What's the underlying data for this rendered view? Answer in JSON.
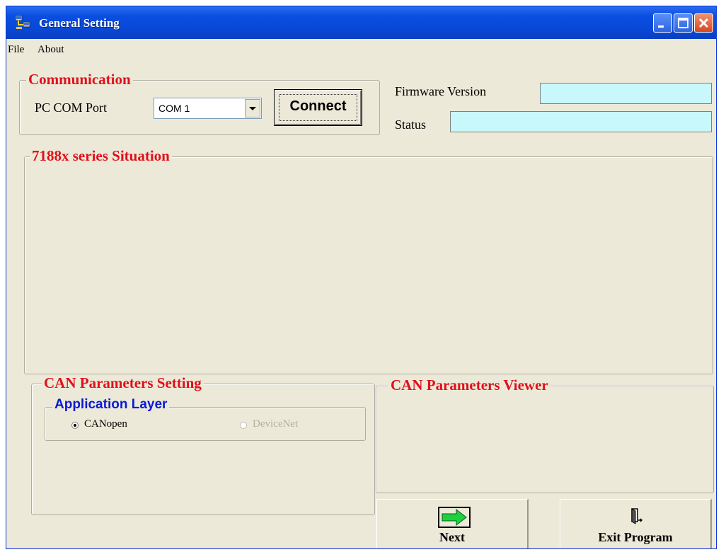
{
  "window": {
    "title": "General Setting",
    "controls": [
      "minimize",
      "maximize",
      "close"
    ]
  },
  "menu": {
    "items": [
      "File",
      "About"
    ]
  },
  "communication": {
    "legend": "Communication",
    "port_label": "PC COM Port",
    "port_value": "COM 1",
    "connect_label": "Connect"
  },
  "info": {
    "firmware_label": "Firmware Version",
    "firmware_value": "",
    "status_label": "Status",
    "status_value": ""
  },
  "situation": {
    "legend": "7188x series Situation"
  },
  "can_setting": {
    "legend": "CAN Parameters Setting",
    "app_layer_legend": "Application Layer",
    "options": [
      {
        "label": "CANopen",
        "selected": true,
        "enabled": true
      },
      {
        "label": "DeviceNet",
        "selected": false,
        "enabled": false
      }
    ]
  },
  "can_viewer": {
    "legend": "CAN Parameters Viewer"
  },
  "buttons": {
    "next_label": "Next",
    "exit_label": "Exit Program"
  },
  "colors": {
    "legend_red": "#e0101a",
    "legend_blue": "#0a1ad8",
    "field_cyan": "#c8f8fc",
    "window_bg": "#ece9d8",
    "titlebar_blue": "#0848d6"
  },
  "icons": {
    "app": "network-computers-icon",
    "next": "green-right-arrow-icon",
    "exit": "door-exit-icon"
  }
}
